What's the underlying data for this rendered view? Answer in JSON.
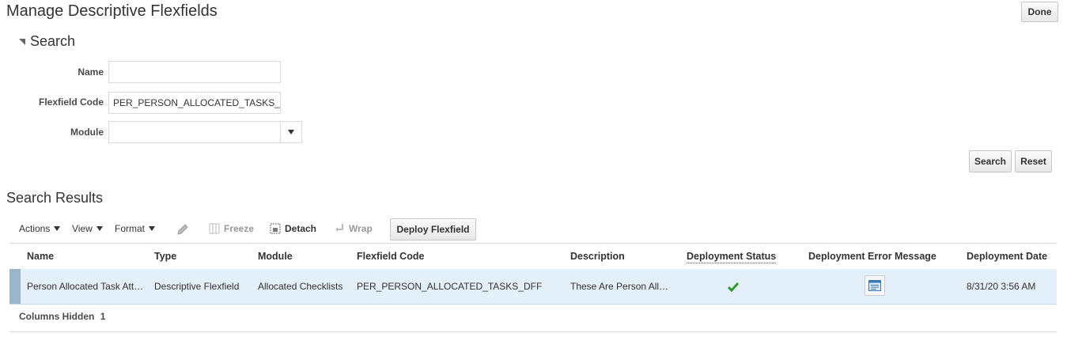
{
  "header": {
    "title": "Manage Descriptive Flexfields",
    "done_label": "Done"
  },
  "search": {
    "title": "Search",
    "fields": {
      "name": {
        "label": "Name",
        "value": ""
      },
      "code": {
        "label": "Flexfield Code",
        "value": "PER_PERSON_ALLOCATED_TASKS_"
      },
      "module": {
        "label": "Module",
        "value": ""
      }
    },
    "search_label": "Search",
    "reset_label": "Reset"
  },
  "results": {
    "title": "Search Results",
    "toolbar": {
      "actions": "Actions",
      "view": "View",
      "format": "Format",
      "freeze": "Freeze",
      "detach": "Detach",
      "wrap": "Wrap",
      "deploy": "Deploy Flexfield"
    },
    "columns": [
      "Name",
      "Type",
      "Module",
      "Flexfield Code",
      "Description",
      "Deployment Status",
      "Deployment Error Message",
      "Deployment Date"
    ],
    "rows": [
      {
        "name": "Person Allocated Task Att…",
        "type": "Descriptive Flexfield",
        "module": "Allocated Checklists",
        "code": "PER_PERSON_ALLOCATED_TASKS_DFF",
        "description": "These Are Person All…",
        "status_icon": "checkmark-icon",
        "error_icon": "message-detail-icon",
        "date": "8/31/20 3:56 AM"
      }
    ],
    "footer": {
      "label": "Columns Hidden",
      "count": "1"
    }
  },
  "colors": {
    "selected_row": "#e3eff9",
    "selected_marker": "#9bb6cc",
    "check": "#2e9b2e"
  }
}
